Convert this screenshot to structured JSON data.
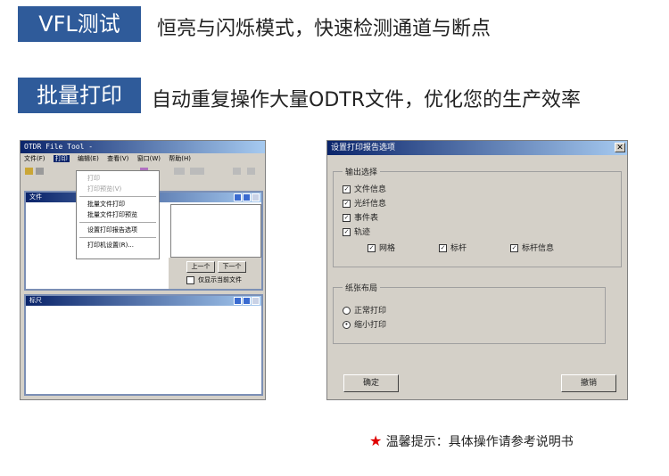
{
  "header": {
    "tag1": "VFL测试",
    "desc1": "恒亮与闪烁模式，快速检测通道与断点",
    "tag2": "批量打印",
    "desc2": "自动重复操作大量ODTR文件，优化您的生产效率"
  },
  "left_window": {
    "title": "OTDR File Tool -",
    "menu": [
      "文件(F)",
      "打印",
      "编辑(E)",
      "查看(V)",
      "窗口(W)",
      "帮助(H)"
    ],
    "dropdown": {
      "disabled": [
        "打印",
        "打印预览(V)"
      ],
      "items": [
        "批量文件打印",
        "批量文件打印预览"
      ],
      "items2": [
        "设置打印报告选项"
      ],
      "items3": [
        "打印机设置(R)..."
      ]
    },
    "child1_title": "文件",
    "prev_button": "上一个",
    "next_button": "下一个",
    "only_current": "仅显示当前文件",
    "child2_title": "标尺"
  },
  "dialog": {
    "title": "设置打印报告选项",
    "close": "✕",
    "output_group": "输出选择",
    "output_items": [
      "文件信息",
      "光纤信息",
      "事件表",
      "轨迹"
    ],
    "trace_items": [
      "网格",
      "标杆",
      "标杆信息"
    ],
    "paper_group": "纸张布局",
    "paper_items": [
      "正常打印",
      "缩小打印"
    ],
    "ok": "确定",
    "cancel": "撤销"
  },
  "note": {
    "star": "★",
    "text": "温馨提示：具体操作请参考说明书"
  }
}
